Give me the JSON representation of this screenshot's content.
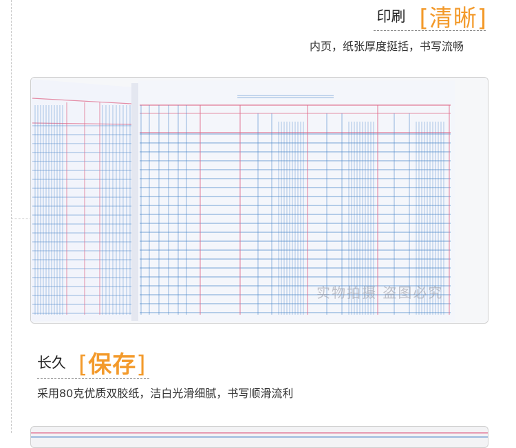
{
  "section1": {
    "title_small": "印刷",
    "title_bracket_open": "[",
    "title_highlight": "清晰",
    "title_bracket_close": "]",
    "subtitle": "内页，纸张厚度挺括，书写流畅"
  },
  "photo1": {
    "watermark": "实物拍摄  盗图必究"
  },
  "section2": {
    "title_small": "长久",
    "title_bracket_open": "[",
    "title_highlight": "保存",
    "title_bracket_close": "]",
    "subtitle": "采用80克优质双胶纸，洁白光滑细腻，书写顺滑流利"
  },
  "colors": {
    "accent": "#f39a2b",
    "ruling_blue": "#4a86c8",
    "ruling_red": "#e06a8a",
    "paper": "#f4f6fb"
  },
  "icons": {
    "divider": "dashed-line"
  }
}
